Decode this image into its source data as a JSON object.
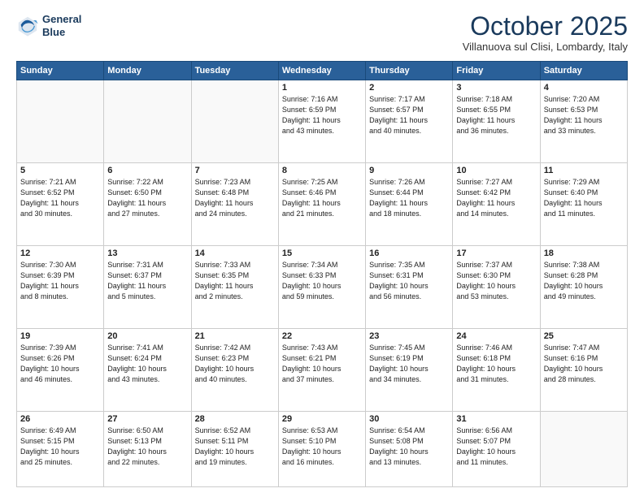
{
  "header": {
    "logo_line1": "General",
    "logo_line2": "Blue",
    "month": "October 2025",
    "location": "Villanuova sul Clisi, Lombardy, Italy"
  },
  "weekdays": [
    "Sunday",
    "Monday",
    "Tuesday",
    "Wednesday",
    "Thursday",
    "Friday",
    "Saturday"
  ],
  "weeks": [
    [
      {
        "day": "",
        "info": ""
      },
      {
        "day": "",
        "info": ""
      },
      {
        "day": "",
        "info": ""
      },
      {
        "day": "1",
        "info": "Sunrise: 7:16 AM\nSunset: 6:59 PM\nDaylight: 11 hours\nand 43 minutes."
      },
      {
        "day": "2",
        "info": "Sunrise: 7:17 AM\nSunset: 6:57 PM\nDaylight: 11 hours\nand 40 minutes."
      },
      {
        "day": "3",
        "info": "Sunrise: 7:18 AM\nSunset: 6:55 PM\nDaylight: 11 hours\nand 36 minutes."
      },
      {
        "day": "4",
        "info": "Sunrise: 7:20 AM\nSunset: 6:53 PM\nDaylight: 11 hours\nand 33 minutes."
      }
    ],
    [
      {
        "day": "5",
        "info": "Sunrise: 7:21 AM\nSunset: 6:52 PM\nDaylight: 11 hours\nand 30 minutes."
      },
      {
        "day": "6",
        "info": "Sunrise: 7:22 AM\nSunset: 6:50 PM\nDaylight: 11 hours\nand 27 minutes."
      },
      {
        "day": "7",
        "info": "Sunrise: 7:23 AM\nSunset: 6:48 PM\nDaylight: 11 hours\nand 24 minutes."
      },
      {
        "day": "8",
        "info": "Sunrise: 7:25 AM\nSunset: 6:46 PM\nDaylight: 11 hours\nand 21 minutes."
      },
      {
        "day": "9",
        "info": "Sunrise: 7:26 AM\nSunset: 6:44 PM\nDaylight: 11 hours\nand 18 minutes."
      },
      {
        "day": "10",
        "info": "Sunrise: 7:27 AM\nSunset: 6:42 PM\nDaylight: 11 hours\nand 14 minutes."
      },
      {
        "day": "11",
        "info": "Sunrise: 7:29 AM\nSunset: 6:40 PM\nDaylight: 11 hours\nand 11 minutes."
      }
    ],
    [
      {
        "day": "12",
        "info": "Sunrise: 7:30 AM\nSunset: 6:39 PM\nDaylight: 11 hours\nand 8 minutes."
      },
      {
        "day": "13",
        "info": "Sunrise: 7:31 AM\nSunset: 6:37 PM\nDaylight: 11 hours\nand 5 minutes."
      },
      {
        "day": "14",
        "info": "Sunrise: 7:33 AM\nSunset: 6:35 PM\nDaylight: 11 hours\nand 2 minutes."
      },
      {
        "day": "15",
        "info": "Sunrise: 7:34 AM\nSunset: 6:33 PM\nDaylight: 10 hours\nand 59 minutes."
      },
      {
        "day": "16",
        "info": "Sunrise: 7:35 AM\nSunset: 6:31 PM\nDaylight: 10 hours\nand 56 minutes."
      },
      {
        "day": "17",
        "info": "Sunrise: 7:37 AM\nSunset: 6:30 PM\nDaylight: 10 hours\nand 53 minutes."
      },
      {
        "day": "18",
        "info": "Sunrise: 7:38 AM\nSunset: 6:28 PM\nDaylight: 10 hours\nand 49 minutes."
      }
    ],
    [
      {
        "day": "19",
        "info": "Sunrise: 7:39 AM\nSunset: 6:26 PM\nDaylight: 10 hours\nand 46 minutes."
      },
      {
        "day": "20",
        "info": "Sunrise: 7:41 AM\nSunset: 6:24 PM\nDaylight: 10 hours\nand 43 minutes."
      },
      {
        "day": "21",
        "info": "Sunrise: 7:42 AM\nSunset: 6:23 PM\nDaylight: 10 hours\nand 40 minutes."
      },
      {
        "day": "22",
        "info": "Sunrise: 7:43 AM\nSunset: 6:21 PM\nDaylight: 10 hours\nand 37 minutes."
      },
      {
        "day": "23",
        "info": "Sunrise: 7:45 AM\nSunset: 6:19 PM\nDaylight: 10 hours\nand 34 minutes."
      },
      {
        "day": "24",
        "info": "Sunrise: 7:46 AM\nSunset: 6:18 PM\nDaylight: 10 hours\nand 31 minutes."
      },
      {
        "day": "25",
        "info": "Sunrise: 7:47 AM\nSunset: 6:16 PM\nDaylight: 10 hours\nand 28 minutes."
      }
    ],
    [
      {
        "day": "26",
        "info": "Sunrise: 6:49 AM\nSunset: 5:15 PM\nDaylight: 10 hours\nand 25 minutes."
      },
      {
        "day": "27",
        "info": "Sunrise: 6:50 AM\nSunset: 5:13 PM\nDaylight: 10 hours\nand 22 minutes."
      },
      {
        "day": "28",
        "info": "Sunrise: 6:52 AM\nSunset: 5:11 PM\nDaylight: 10 hours\nand 19 minutes."
      },
      {
        "day": "29",
        "info": "Sunrise: 6:53 AM\nSunset: 5:10 PM\nDaylight: 10 hours\nand 16 minutes."
      },
      {
        "day": "30",
        "info": "Sunrise: 6:54 AM\nSunset: 5:08 PM\nDaylight: 10 hours\nand 13 minutes."
      },
      {
        "day": "31",
        "info": "Sunrise: 6:56 AM\nSunset: 5:07 PM\nDaylight: 10 hours\nand 11 minutes."
      },
      {
        "day": "",
        "info": ""
      }
    ]
  ]
}
